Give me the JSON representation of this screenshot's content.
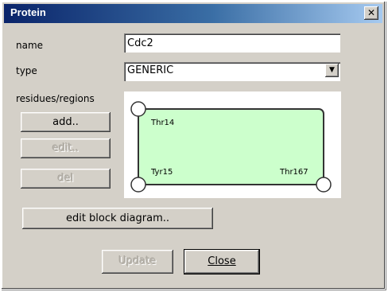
{
  "window": {
    "title": "Protein",
    "close_glyph": "✕"
  },
  "form": {
    "name_label": "name",
    "name_value": "Cdc2",
    "type_label": "type",
    "type_value": "GENERIC",
    "residues_label": "residues/regions"
  },
  "buttons": {
    "add": "add..",
    "edit": "edit..",
    "del": "del",
    "edit_block": "edit block diagram..",
    "update": "Update",
    "close": "Close"
  },
  "diagram": {
    "fill_color": "#ccffcc",
    "stroke_color": "#333333",
    "residues": [
      "Thr14",
      "Tyr15",
      "Thr167"
    ]
  },
  "icons": {
    "dropdown": "chevron-down-icon"
  }
}
